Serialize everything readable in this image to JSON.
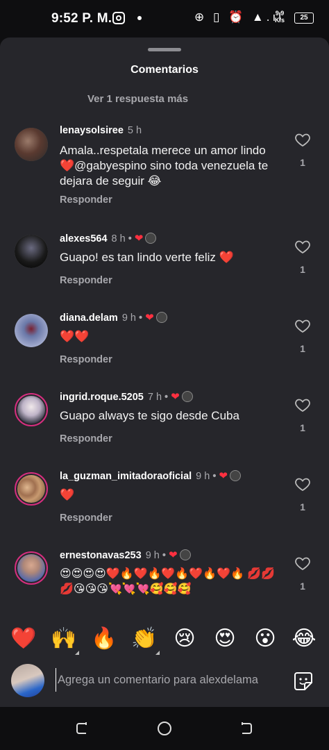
{
  "status_bar": {
    "time": "9:52 P. M.",
    "speed_value": "9.9",
    "speed_unit": "K/s",
    "battery": "25"
  },
  "sheet": {
    "title": "Comentarios",
    "more_replies": "Ver 1 respuesta más"
  },
  "comments": [
    {
      "username": "lenaysolsiree",
      "time": "5 h",
      "text": "Amala..respetala merece un amor lindo ❤️@gabyespino  sino toda venezuela te dejara de seguir 😂",
      "reply": "Responder",
      "likes": "1",
      "liked_by_author": false
    },
    {
      "username": "alexes564",
      "time": "8 h",
      "text": "Guapo! es tan lindo verte feliz ❤️",
      "reply": "Responder",
      "likes": "1",
      "liked_by_author": true
    },
    {
      "username": "diana.delam",
      "time": "9 h",
      "text": "❤️❤️",
      "reply": "Responder",
      "likes": "1",
      "liked_by_author": true
    },
    {
      "username": "ingrid.roque.5205",
      "time": "7 h",
      "text": "Guapo always te sigo desde Cuba",
      "reply": "Responder",
      "likes": "1",
      "liked_by_author": true
    },
    {
      "username": "la_guzman_imitadoraoficial",
      "time": "9 h",
      "text": "❤️",
      "reply": "Responder",
      "likes": "1",
      "liked_by_author": true
    },
    {
      "username": "ernestonavas253",
      "time": "9 h",
      "text": "😍😍😍😍❤️🔥❤️🔥❤️🔥❤️🔥❤️🔥 💋💋💋😘😘😘💘💘💘🥰🥰🥰",
      "reply": "",
      "likes": "1",
      "liked_by_author": true
    }
  ],
  "quick_reactions": [
    "❤️",
    "🙌",
    "🔥",
    "👏",
    "😢",
    "😍",
    "😮",
    "😂"
  ],
  "composer": {
    "placeholder": "Agrega un comentario para alexdelama"
  },
  "colors": {
    "sheet_bg": "#26262b",
    "like_red": "#ff3040",
    "muted_text": "#a8a8ad",
    "story_ring": "#d62e7f"
  }
}
